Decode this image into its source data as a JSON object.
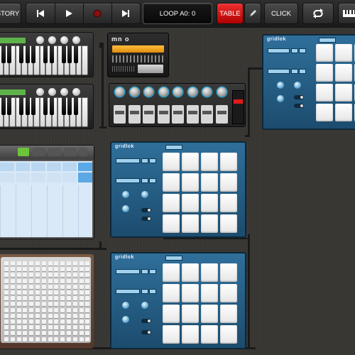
{
  "toolbar": {
    "history_label": "STORY",
    "loop_label": "LOOP A0: 0",
    "table_label": "TABLE",
    "click_label": "CLICK"
  },
  "mono_synth": {
    "brand": "mn o"
  },
  "gridlok": {
    "brand": "gridlok"
  },
  "colors": {
    "toolbar_bg": "#222222",
    "active_red": "#e11d1d",
    "gridlok_blue": "#2a6a93",
    "workspace_bg": "#383633",
    "keyboard_lcd_green": "#5fb24a",
    "mono_lcd_orange": "#f0a020"
  },
  "icons": [
    "skip-back-icon",
    "play-icon",
    "record-icon",
    "skip-forward-icon",
    "pencil-icon",
    "loop-icon",
    "keyboard-icon"
  ]
}
